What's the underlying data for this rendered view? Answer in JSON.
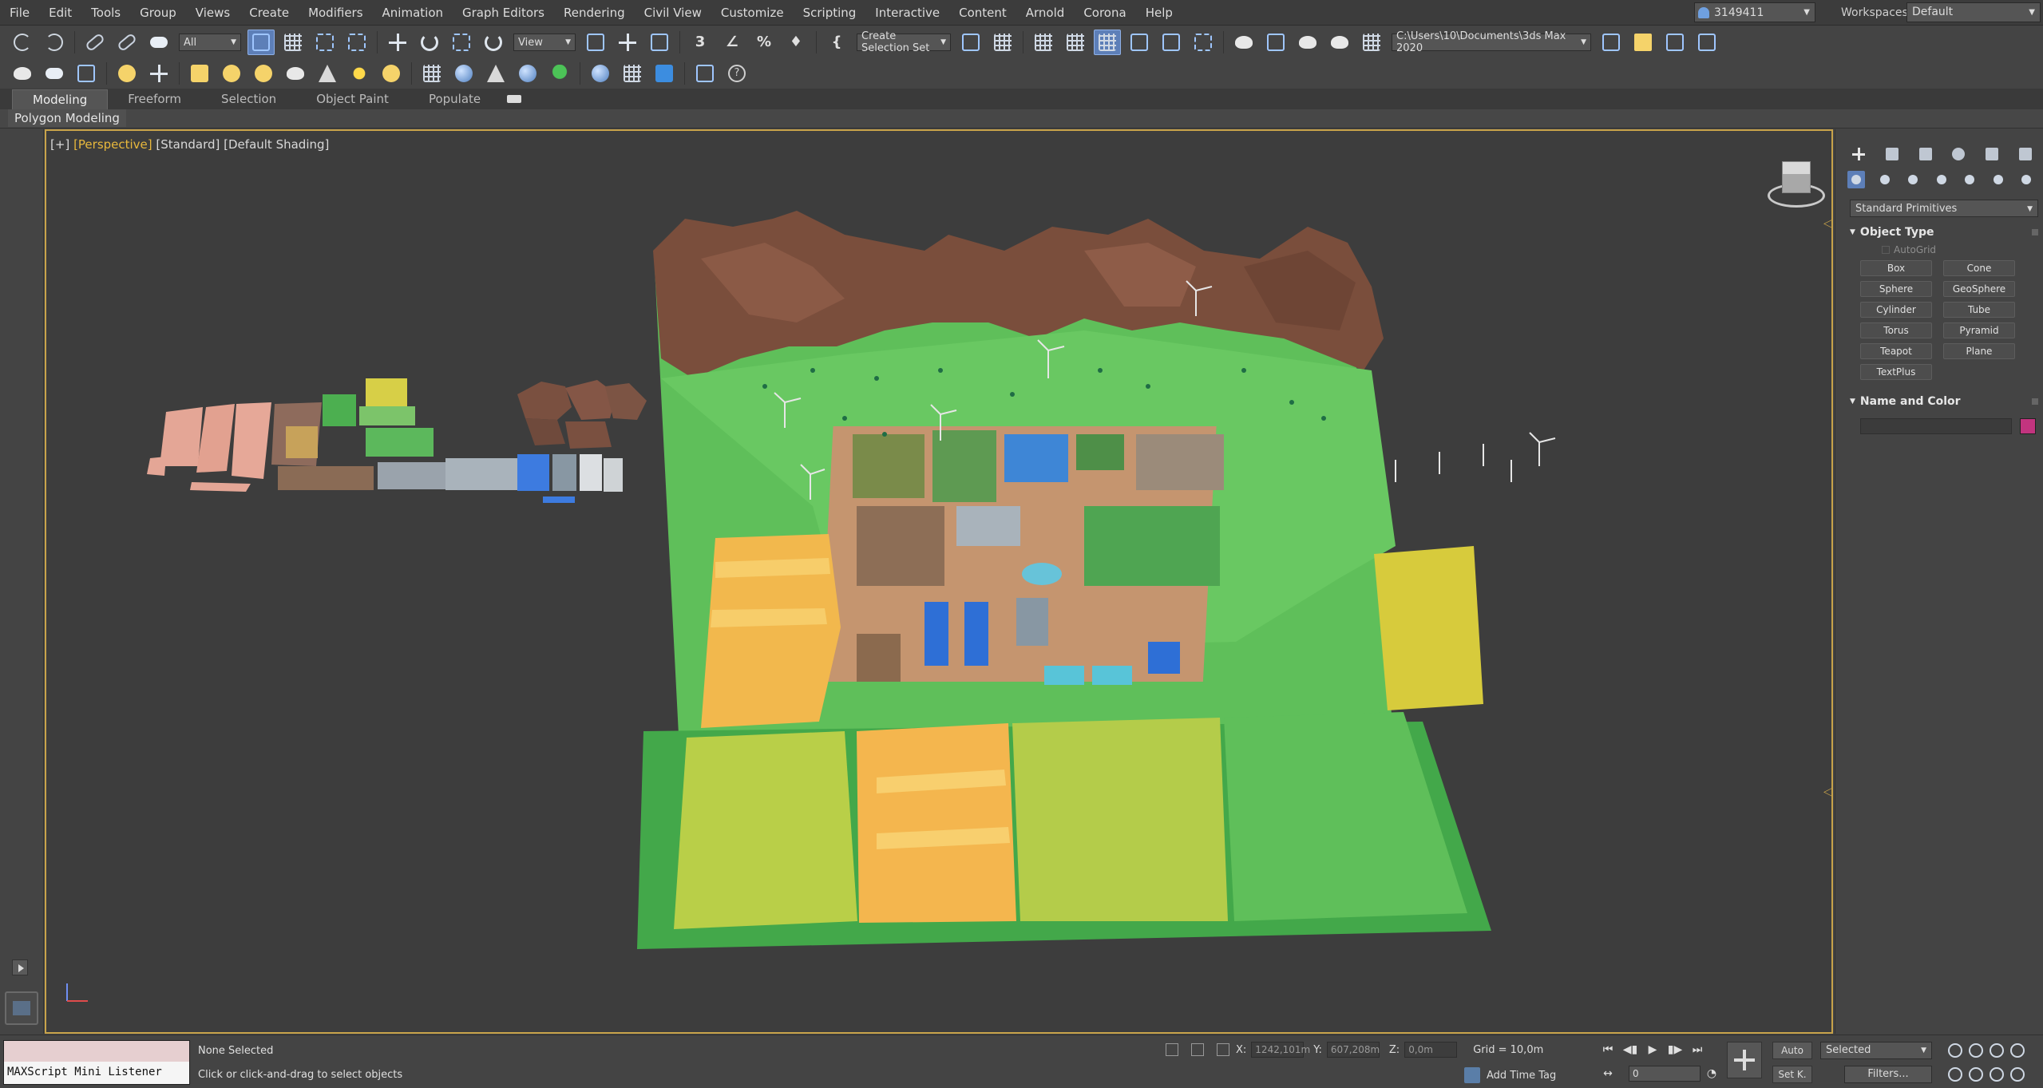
{
  "menubar": {
    "items": [
      "File",
      "Edit",
      "Tools",
      "Group",
      "Views",
      "Create",
      "Modifiers",
      "Animation",
      "Graph Editors",
      "Rendering",
      "Civil View",
      "Customize",
      "Scripting",
      "Interactive",
      "Content",
      "Arnold",
      "Corona",
      "Help"
    ],
    "user": "3149411",
    "workspaces_label": "Workspaces:",
    "workspace": "Default"
  },
  "toolbar1": {
    "filter": "All",
    "ref_coord": "View",
    "selection_set": "Create Selection Set",
    "project_path": "C:\\Users\\10\\Documents\\3ds Max 2020",
    "percent": "%"
  },
  "ribbon": {
    "tabs": [
      "Modeling",
      "Freeform",
      "Selection",
      "Object Paint",
      "Populate"
    ],
    "active_tab": "Modeling",
    "panel_label": "Polygon Modeling"
  },
  "viewport": {
    "label_plus": "[+]",
    "label_view": "[Perspective]",
    "label_standard": "[Standard]",
    "label_shading": "[Default Shading]",
    "accent": "#c8a34a"
  },
  "command_panel": {
    "category": "Standard Primitives",
    "object_type_title": "Object Type",
    "autogrid": "AutoGrid",
    "primitives": [
      "Box",
      "Cone",
      "Sphere",
      "GeoSphere",
      "Cylinder",
      "Tube",
      "Torus",
      "Pyramid",
      "Teapot",
      "Plane",
      "TextPlus"
    ],
    "name_color_title": "Name and Color",
    "object_color": "#c2347f"
  },
  "status": {
    "maxscript": "MAXScript Mini Listener",
    "selection": "None Selected",
    "prompt": "Click or click-and-drag to select objects",
    "x_label": "X:",
    "x_value": "1242,101m",
    "y_label": "Y:",
    "y_value": "607,208m",
    "z_label": "Z:",
    "z_value": "0,0m",
    "grid": "Grid = 10,0m",
    "add_time_tag": "Add Time Tag",
    "frame": "0",
    "auto_key": "Auto",
    "set_key": "Set K.",
    "key_filter": "Selected",
    "filters": "Filters..."
  }
}
